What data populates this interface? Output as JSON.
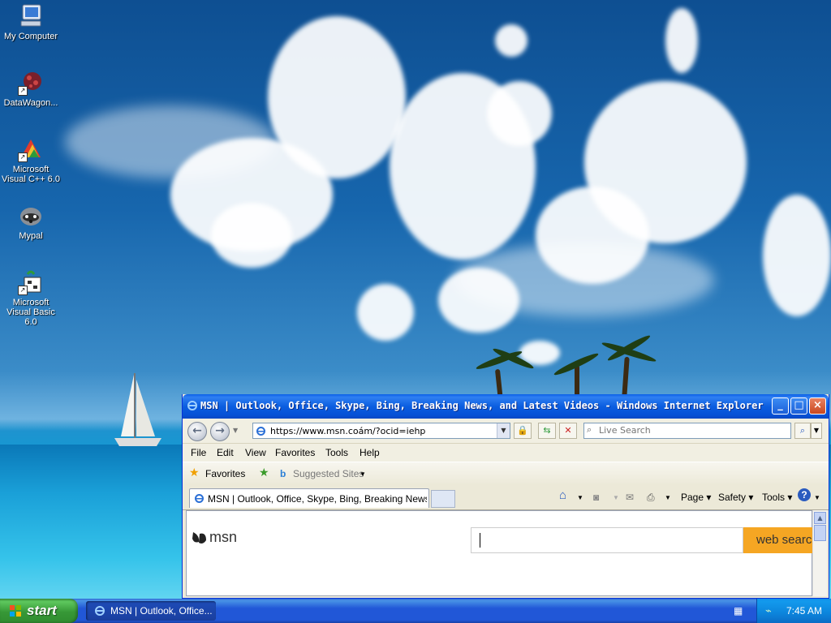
{
  "desktop": {
    "icons": [
      {
        "label": "My Computer",
        "icon": "computer-icon"
      },
      {
        "label": "DataWagon...",
        "icon": "datawagon-icon"
      },
      {
        "label": "Microsoft Visual C++ 6.0",
        "icon": "visual-cpp-icon"
      },
      {
        "label": "Mypal",
        "icon": "mypal-icon"
      },
      {
        "label": "Microsoft Visual Basic 6.0",
        "icon": "visual-basic-icon"
      }
    ]
  },
  "browser": {
    "title": "MSN | Outlook, Office, Skype, Bing, Breaking News, and Latest Videos - Windows Internet Explorer",
    "address": "https://www.msn.coám/?ocid=iehp",
    "search_placeholder": "Live Search",
    "menu": [
      "File",
      "Edit",
      "View",
      "Favorites",
      "Tools",
      "Help"
    ],
    "favorites_label": "Favorites",
    "suggested_sites_label": "Suggested Sites",
    "tab_title": "MSN | Outlook, Office, Skype, Bing, Breaking News, a...",
    "commands": {
      "page": "Page",
      "safety": "Safety",
      "tools": "Tools"
    },
    "page": {
      "logo_text": "msn",
      "search_button": "web search"
    }
  },
  "taskbar": {
    "start_label": "start",
    "task_label": "MSN | Outlook, Office...",
    "clock": "7:45 AM"
  },
  "colors": {
    "titlebar_blue": "#0b5ee0",
    "start_green": "#379837",
    "msn_search_orange": "#f5a623"
  }
}
